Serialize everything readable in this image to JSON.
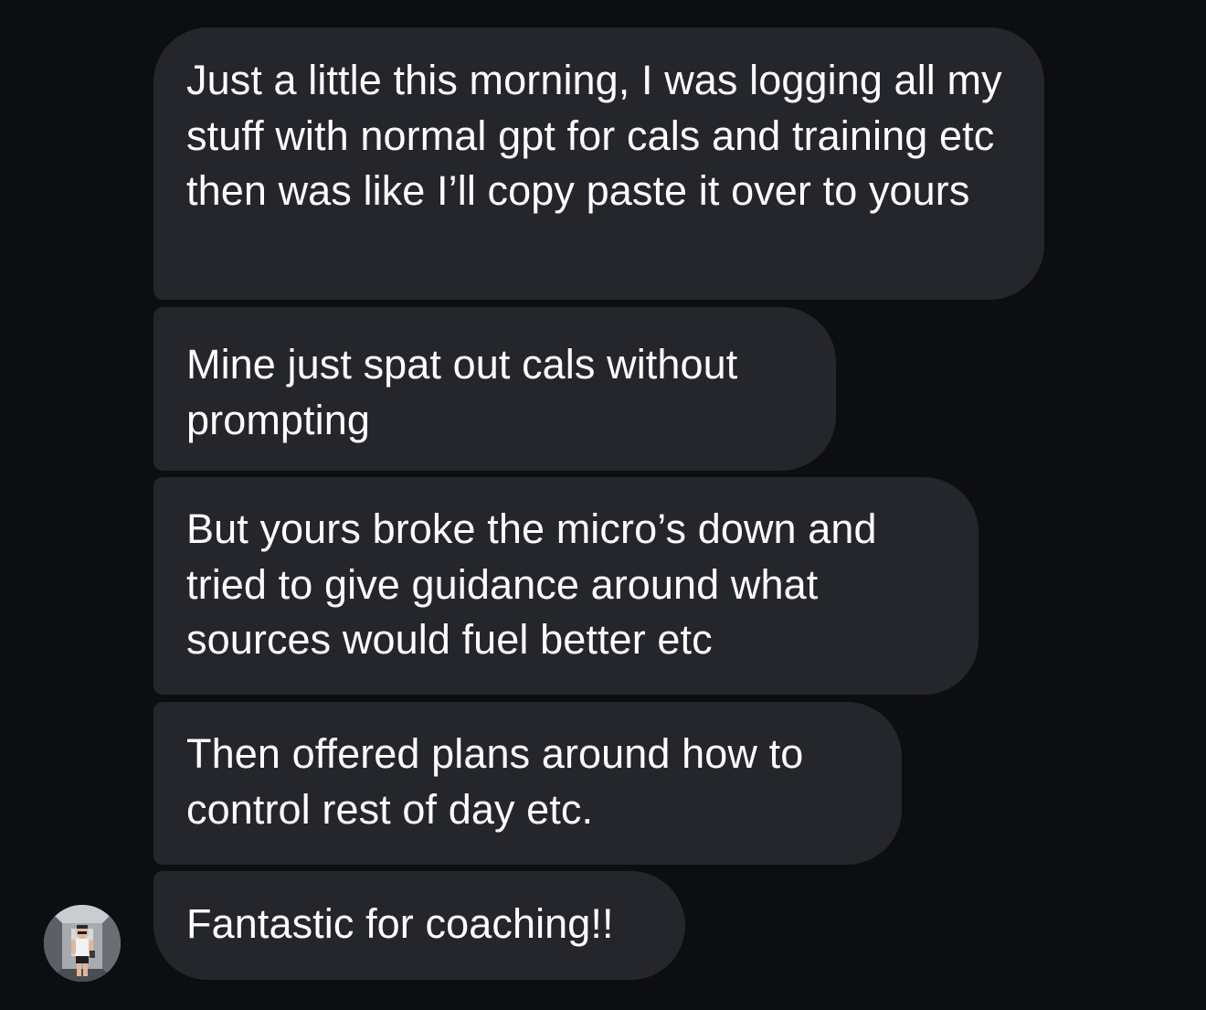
{
  "conversation": {
    "messages": [
      {
        "text": "Just a little this morning, I was logging all my stuff with normal gpt for cals and training etc then was like I’ll copy paste it over to yours"
      },
      {
        "text": "Mine just spat out cals without prompting"
      },
      {
        "text": "But yours broke the micro’s down and tried to give guidance around what sources would fuel better etc"
      },
      {
        "text": "Then offered plans around how to control rest of day etc."
      },
      {
        "text": "Fantastic for coaching!!"
      }
    ],
    "sender_avatar": "user-avatar-photo"
  },
  "colors": {
    "background": "#0d0e12",
    "bubble": "#25262b",
    "text": "#ffffff"
  }
}
